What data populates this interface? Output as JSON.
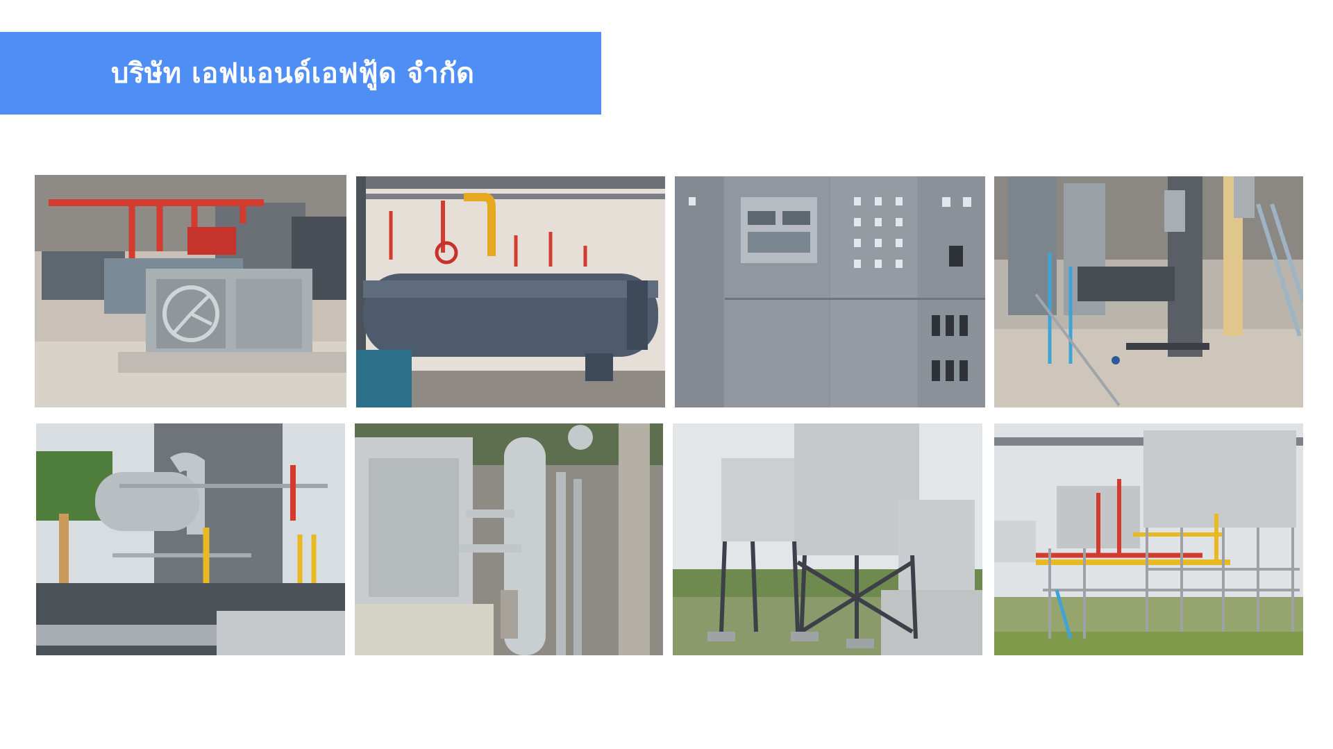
{
  "slide": {
    "title": "บริษัท เอฟแอนด์เอฟฟู้ด จำกัด",
    "accent_color": "#4f8ef5"
  },
  "photos": [
    {
      "subject": "refrigeration-compressor-unit"
    },
    {
      "subject": "horizontal-pressure-vessel"
    },
    {
      "subject": "electrical-control-panel"
    },
    {
      "subject": "insulated-piping-and-valves"
    },
    {
      "subject": "insulated-vessel-and-piping-outdoor"
    },
    {
      "subject": "stainless-cabinet-and-vertical-vessel"
    },
    {
      "subject": "evaporative-condensers-on-steel-frames"
    },
    {
      "subject": "condenser-platform-with-colored-pipes"
    }
  ]
}
